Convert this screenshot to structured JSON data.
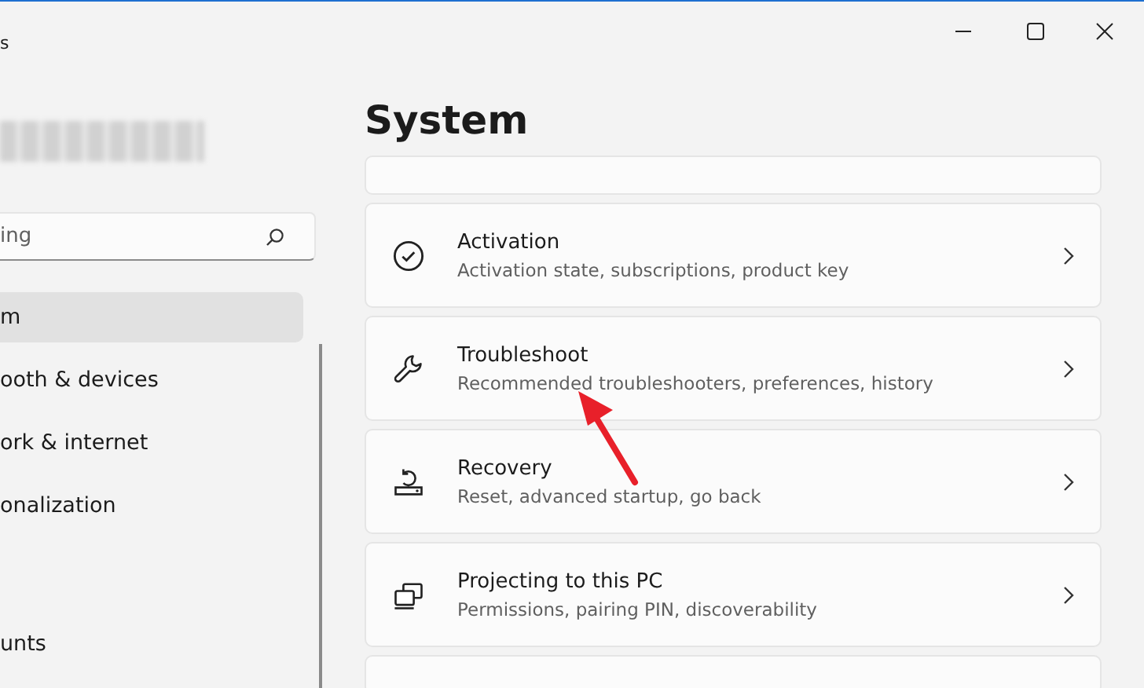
{
  "window": {
    "title": "s"
  },
  "sidebar": {
    "search": {
      "placeholder": "ing"
    },
    "items": [
      {
        "label": "m",
        "selected": true
      },
      {
        "label": "ooth & devices",
        "selected": false
      },
      {
        "label": "ork & internet",
        "selected": false
      },
      {
        "label": "onalization",
        "selected": false
      },
      {
        "label": "unts",
        "selected": false
      }
    ]
  },
  "page": {
    "title": "System",
    "cards": [
      {
        "kind": "partial"
      },
      {
        "kind": "activation",
        "title": "Activation",
        "subtitle": "Activation state, subscriptions, product key"
      },
      {
        "kind": "troubleshoot",
        "title": "Troubleshoot",
        "subtitle": "Recommended troubleshooters, preferences, history"
      },
      {
        "kind": "recovery",
        "title": "Recovery",
        "subtitle": "Reset, advanced startup, go back"
      },
      {
        "kind": "projecting",
        "title": "Projecting to this PC",
        "subtitle": "Permissions, pairing PIN, discoverability"
      },
      {
        "kind": "partial"
      }
    ]
  }
}
